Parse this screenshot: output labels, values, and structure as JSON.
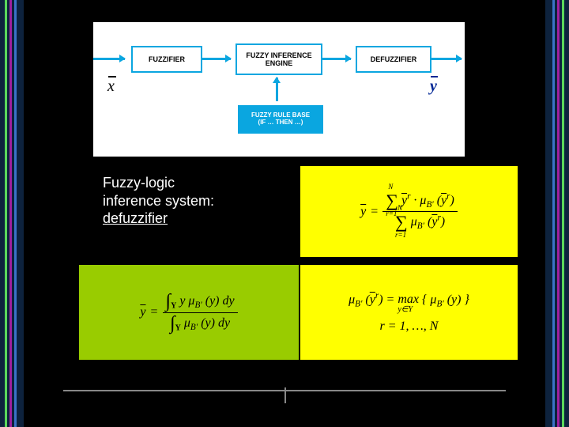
{
  "diagram": {
    "fuzzifier": "FUZZIFIER",
    "engine": "FUZZY INFERENCE\nENGINE",
    "defuzzifier": "DEFUZZIFIER",
    "rulebase": "FUZZY RULE BASE\n(IF … THEN …)",
    "x": "x",
    "y": "y"
  },
  "caption": {
    "line1": "Fuzzy-logic",
    "line2": "inference system:",
    "line3": "defuzzifier"
  },
  "formula_discrete": {
    "lhs": "y",
    "num": "∑",
    "num_limits_top": "N",
    "num_limits_bot": "r=1",
    "num_term": "yʳ · μB′ (yʳ)",
    "den": "∑",
    "den_limits_top": "N",
    "den_limits_bot": "r=1",
    "den_term": "μB′ (yʳ)"
  },
  "formula_continuous": {
    "lhs": "y",
    "num_int": "∫",
    "num_term": "y μB′ (y) dy",
    "den_int": "∫",
    "den_term": "μB′ (y) dy",
    "domain": "Y"
  },
  "formula_max": {
    "line1": "μB′ (yʳ) = max { μB′ (y) }",
    "cond": "y∈Y",
    "line2": "r = 1, …, N"
  }
}
